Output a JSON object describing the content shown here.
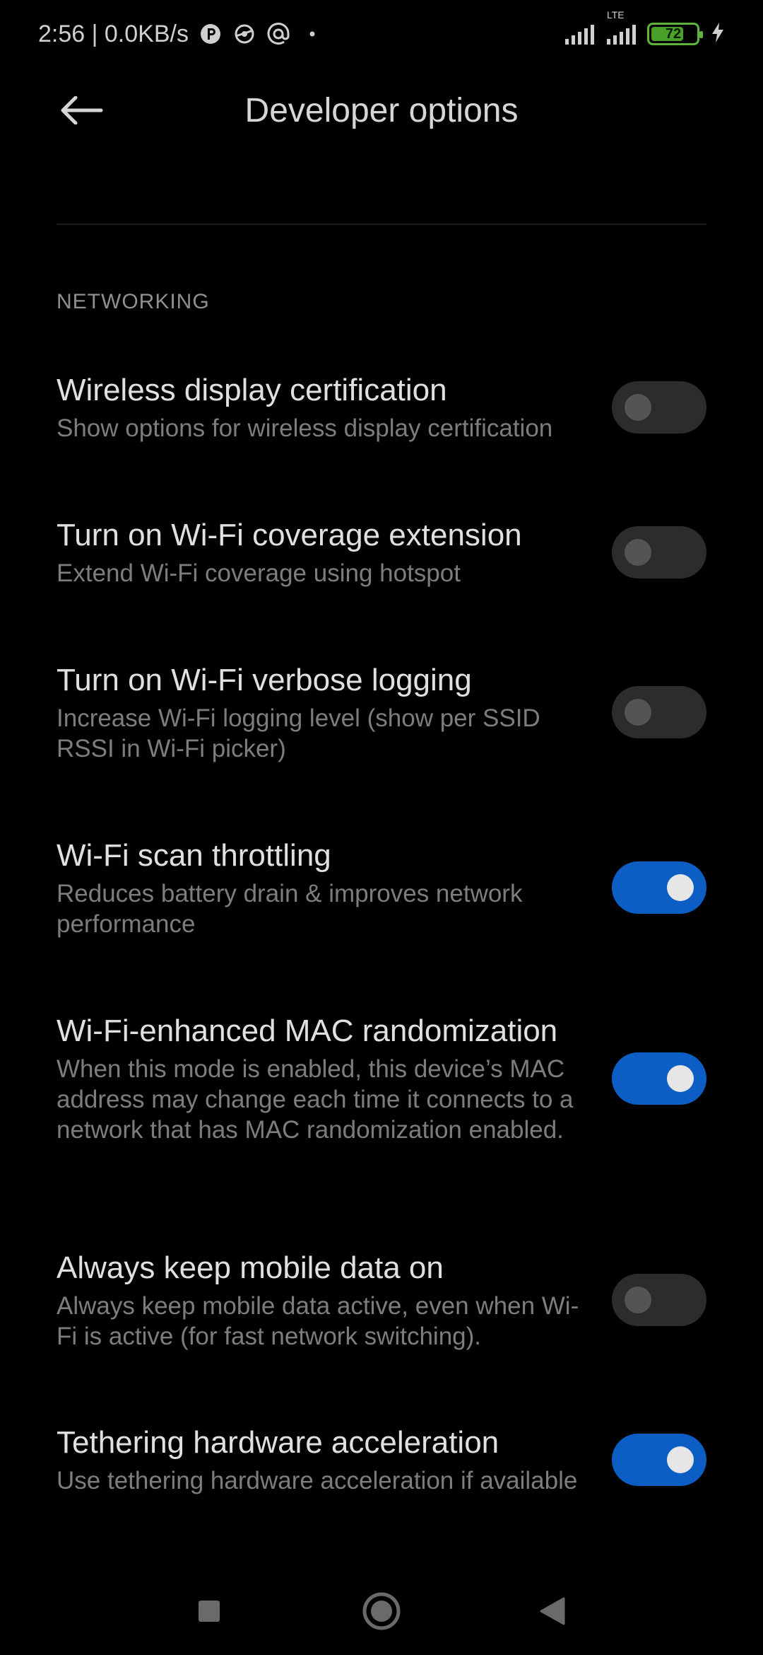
{
  "status_bar": {
    "time_speed": "2:56 | 0.0KB/s",
    "network_type": "LTE",
    "battery_level": 72,
    "battery_text": "72",
    "icons": [
      "notification-p-icon",
      "app-icon",
      "at-icon",
      "dot-icon",
      "signal-icon",
      "lte-signal-icon",
      "battery-icon",
      "charging-icon"
    ]
  },
  "header": {
    "title": "Developer options",
    "back_icon": "arrow-left-icon"
  },
  "section": {
    "label": "NETWORKING"
  },
  "settings": [
    {
      "title": "Wireless display certification",
      "subtitle": "Show options for wireless display certification",
      "enabled": false
    },
    {
      "title": "Turn on Wi-Fi coverage extension",
      "subtitle": "Extend Wi-Fi coverage using hotspot",
      "enabled": false
    },
    {
      "title": "Turn on Wi-Fi verbose logging",
      "subtitle": "Increase Wi-Fi logging level (show per SSID RSSI in Wi-Fi picker)",
      "enabled": false
    },
    {
      "title": "Wi-Fi scan throttling",
      "subtitle": "Reduces battery drain & improves network performance",
      "enabled": true
    },
    {
      "title": "Wi-Fi-enhanced MAC randomization",
      "subtitle": "When this mode is enabled, this device’s MAC address may change each time it connects to a network that has MAC randomization enabled.",
      "enabled": true
    },
    {
      "title": "Always keep mobile data on",
      "subtitle": "Always keep mobile data active, even when Wi-Fi is active (for fast network switching).",
      "enabled": false
    },
    {
      "title": "Tethering hardware acceleration",
      "subtitle": "Use tethering hardware acceleration if available",
      "enabled": true
    }
  ],
  "colors": {
    "background": "#000000",
    "toggle_on": "#0c5ec4",
    "toggle_off": "#2c2c2c",
    "battery": "#5fb33a"
  },
  "nav_bar": {
    "icons": [
      "recents-square-icon",
      "home-circle-icon",
      "back-triangle-icon"
    ]
  }
}
